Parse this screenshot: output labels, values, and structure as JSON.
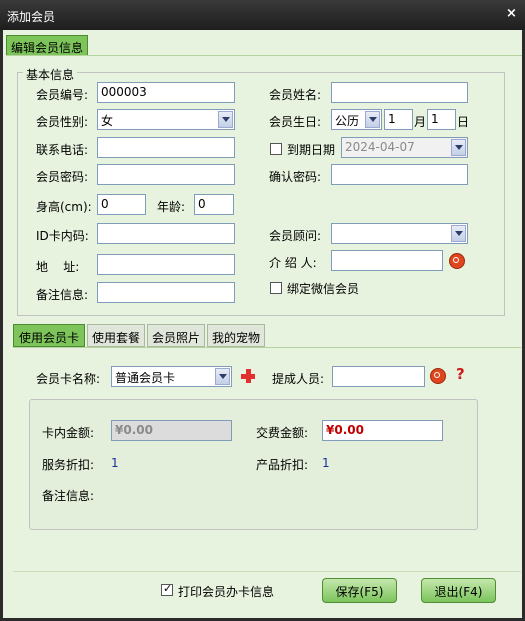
{
  "window": {
    "title": "添加会员",
    "close": "×"
  },
  "top_tab": "编辑会员信息",
  "basic": {
    "group_title": "基本信息",
    "member_no_label": "会员编号:",
    "member_no": "000003",
    "member_name_label": "会员姓名:",
    "member_name": "",
    "gender_label": "会员性别:",
    "gender": "女",
    "birthday_label": "会员生日:",
    "calendar": "公历",
    "month": "1",
    "month_unit": "月",
    "day": "1",
    "day_unit": "日",
    "phone_label": "联系电话:",
    "phone": "",
    "expire_label": "到期日期",
    "expire_date": "2024-04-07",
    "password_label": "会员密码:",
    "password": "",
    "confirm_label": "确认密码:",
    "confirm": "",
    "height_label": "身高(cm):",
    "height": "0",
    "age_label": "年龄:",
    "age": "0",
    "idcard_label": "ID卡内码:",
    "idcard": "",
    "advisor_label": "会员顾问:",
    "advisor": "",
    "address_label": "地    址:",
    "address": "",
    "referrer_label": "介 绍 人:",
    "referrer": "",
    "remark_label": "备注信息:",
    "remark": "",
    "wechat_label": "绑定微信会员"
  },
  "tabs": [
    "使用会员卡",
    "使用套餐",
    "会员照片",
    "我的宠物"
  ],
  "card": {
    "card_name_label": "会员卡名称:",
    "card_name": "普通会员卡",
    "commission_label": "提成人员:",
    "commission": "",
    "help": "?",
    "balance_label": "卡内金额:",
    "balance": "¥0.00",
    "pay_label": "交费金额:",
    "pay": "¥0.00",
    "service_discount_label": "服务折扣:",
    "service_discount": "1",
    "product_discount_label": "产品折扣:",
    "product_discount": "1",
    "remark_label": "备注信息:"
  },
  "footer": {
    "print_label": "打印会员办卡信息",
    "save_label": "保存(F5)",
    "exit_label": "退出(F4)"
  },
  "colors": {
    "accent": "#7dc45a",
    "background": "#e8f3df",
    "amount_red": "#c00000"
  }
}
